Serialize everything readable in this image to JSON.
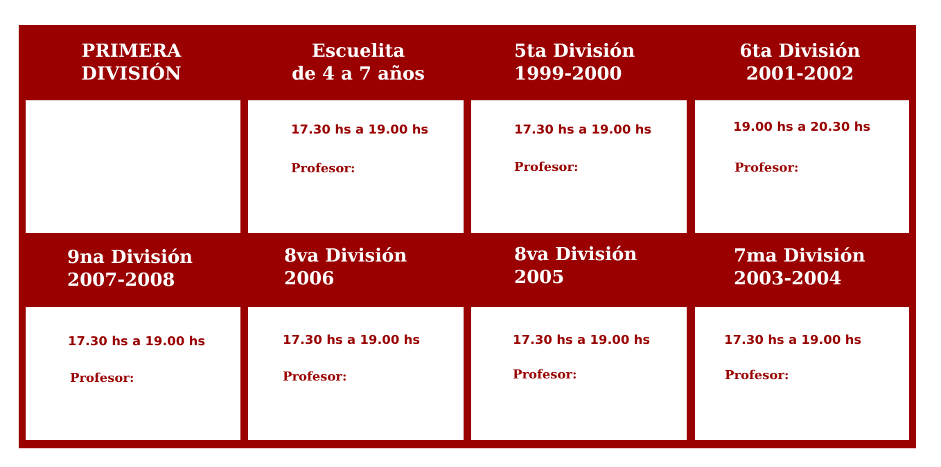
{
  "categories": [
    {
      "title_line1": "PRIMERA",
      "title_line2": "DIVISIÓN",
      "schedule": "",
      "teacher": ""
    },
    {
      "title_line1": "Escuelita",
      "title_line2": "de 4 a 7 años",
      "schedule": "17.30 hs a 19.00 hs",
      "teacher": "Profesor:"
    },
    {
      "title_line1": "5ta División",
      "title_line2": "1999-2000",
      "schedule": "17.30 hs a 19.00 hs",
      "teacher": "Profesor:"
    },
    {
      "title_line1": "6ta División",
      "title_line2": "2001-2002",
      "schedule": "19.00 hs a 20.30 hs",
      "teacher": "Profesor:"
    },
    {
      "title_line1": "9na División",
      "title_line2": "2007-2008",
      "schedule": "17.30 hs a 19.00 hs",
      "teacher": "Profesor:"
    },
    {
      "title_line1": "8va División",
      "title_line2": "2006",
      "schedule": "17.30 hs a 19.00 hs",
      "teacher": "Profesor:"
    },
    {
      "title_line1": "8va División",
      "title_line2": "2005",
      "schedule": "17.30 hs a 19.00 hs",
      "teacher": "Profesor:"
    },
    {
      "title_line1": "7ma División",
      "title_line2": "2003-2004",
      "schedule": "17.30 hs a 19.00 hs",
      "teacher": "Profesor:"
    }
  ],
  "colors": {
    "brand": "#9a0000",
    "background": "#ffffff"
  }
}
